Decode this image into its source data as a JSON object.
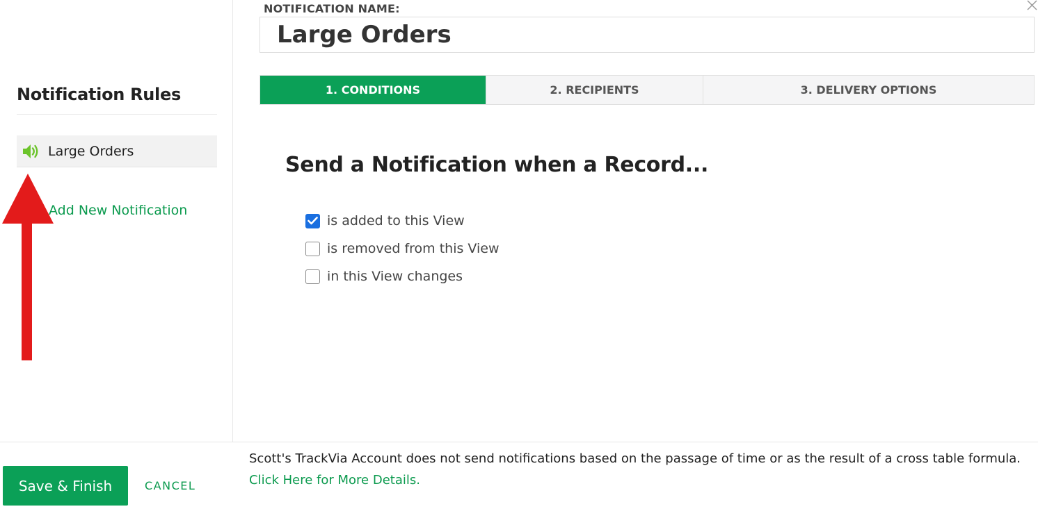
{
  "sidebar": {
    "title": "Notification Rules",
    "rules": [
      {
        "label": "Large Orders",
        "icon": "speaker-icon"
      }
    ],
    "add_new_label": "Add New Notification"
  },
  "form": {
    "name_label": "NOTIFICATION NAME:",
    "name_value": "Large Orders",
    "tabs": [
      {
        "label": "1. CONDITIONS",
        "active": true
      },
      {
        "label": "2. RECIPIENTS",
        "active": false
      },
      {
        "label": "3. DELIVERY OPTIONS",
        "active": false
      }
    ],
    "heading": "Send a Notification when a Record...",
    "conditions": [
      {
        "label": "is added to this View",
        "checked": true
      },
      {
        "label": "is removed from this View",
        "checked": false
      },
      {
        "label": "in this View changes",
        "checked": false
      }
    ]
  },
  "footer": {
    "save_label": "Save & Finish",
    "cancel_label": "CANCEL",
    "note_text": "Scott's TrackVia Account does not send notifications based on the passage of time or as the result of a cross table formula. ",
    "note_link": "Click Here for More Details."
  },
  "colors": {
    "brand_green": "#0ba057",
    "checkbox_blue": "#1a6fe0",
    "annotation_red": "#e31b1b"
  }
}
